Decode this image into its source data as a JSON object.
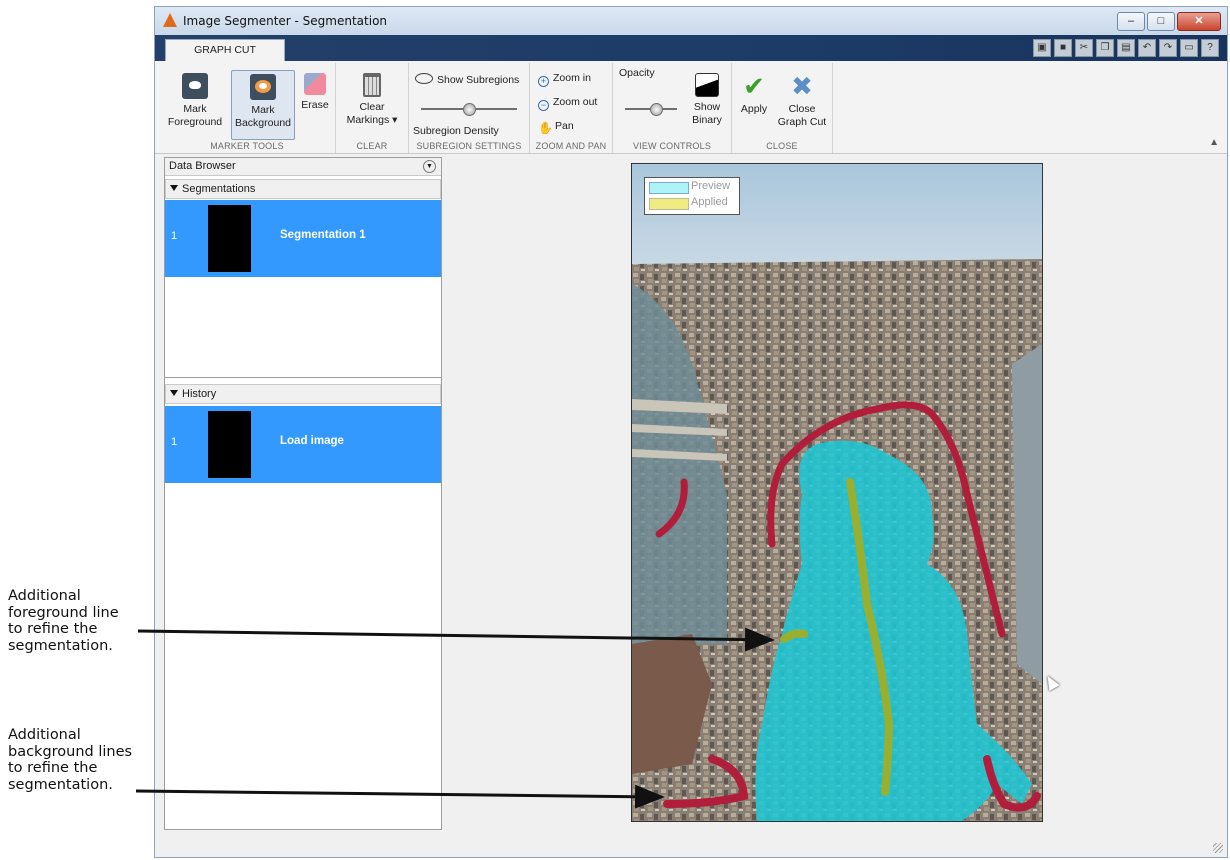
{
  "annotations": {
    "foreground": "Additional\nforeground line\nto refine the\nsegmentation.",
    "background": "Additional\nbackground lines\nto refine the\nsegmentation."
  },
  "window": {
    "title": "Image Segmenter - Segmentation",
    "controls": [
      "–",
      "□",
      "✕"
    ]
  },
  "tab": {
    "label": "GRAPH CUT"
  },
  "ribbon": {
    "marker_tools": {
      "group_label": "MARKER TOOLS",
      "mark_foreground": "Mark\nForeground",
      "mark_background": "Mark\nBackground",
      "erase": "Erase"
    },
    "clear": {
      "group_label": "CLEAR",
      "clear_markings": "Clear\nMarkings ▾"
    },
    "subregion": {
      "group_label": "SUBREGION SETTINGS",
      "show_subregions": "Show Subregions",
      "density": "Subregion Density"
    },
    "zoom_pan": {
      "group_label": "ZOOM AND PAN",
      "zoom_in": "Zoom in",
      "zoom_out": "Zoom out",
      "pan": "Pan"
    },
    "view": {
      "group_label": "VIEW CONTROLS",
      "opacity": "Opacity",
      "show_binary": "Show\nBinary"
    },
    "close": {
      "group_label": "CLOSE",
      "apply": "Apply",
      "close_graph_cut": "Close\nGraph Cut"
    }
  },
  "data_browser": {
    "title": "Data Browser",
    "segmentations": {
      "header": "Segmentations",
      "items": [
        {
          "index": "1",
          "name": "Segmentation 1"
        }
      ]
    },
    "history": {
      "header": "History",
      "items": [
        {
          "index": "1",
          "name": "Load image"
        }
      ]
    }
  },
  "legend": {
    "preview": "Preview",
    "applied": "Applied"
  },
  "colors": {
    "accent_selected": "#3399ff",
    "foreground_mark": "#9aaf2e",
    "background_mark": "#b01e3c",
    "preview_overlay": "#1fc7d4",
    "applied_overlay": "#f0ec82",
    "title_bar": "#c9d8ea",
    "tab_strip": "#1c3b67"
  }
}
